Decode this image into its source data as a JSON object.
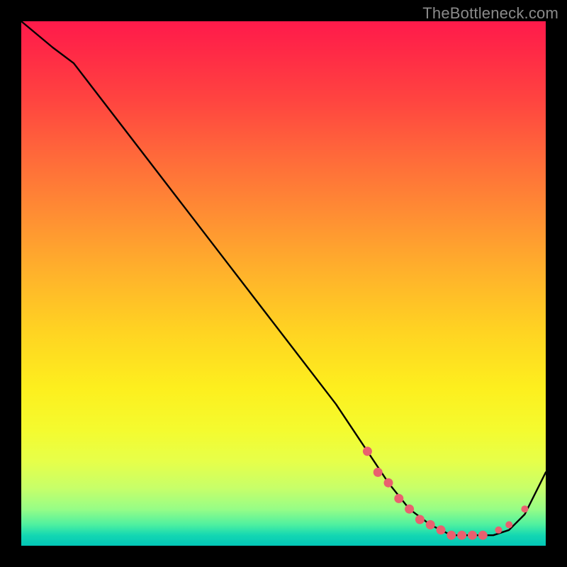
{
  "watermark": "TheBottleneck.com",
  "chart_data": {
    "type": "line",
    "title": "",
    "xlabel": "",
    "ylabel": "",
    "xlim": [
      0,
      100
    ],
    "ylim": [
      0,
      100
    ],
    "series": [
      {
        "name": "curve",
        "x": [
          0,
          6,
          10,
          20,
          30,
          40,
          50,
          60,
          66,
          70,
          74,
          78,
          82,
          86,
          90,
          93,
          96,
          100
        ],
        "values": [
          100,
          95,
          92,
          79,
          66,
          53,
          40,
          27,
          18,
          12,
          7,
          4,
          2,
          2,
          2,
          3,
          6,
          14
        ]
      }
    ],
    "markers": {
      "name": "highlight-dots",
      "x": [
        66,
        68,
        70,
        72,
        74,
        76,
        78,
        80,
        82,
        84,
        86,
        88,
        91,
        93,
        96
      ],
      "values": [
        18,
        14,
        12,
        9,
        7,
        5,
        4,
        3,
        2,
        2,
        2,
        2,
        3,
        4,
        7
      ],
      "color": "#e9606f"
    },
    "gradient_stops": [
      {
        "pos": 0,
        "color": "#ff1a4b"
      },
      {
        "pos": 15,
        "color": "#ff4440"
      },
      {
        "pos": 37,
        "color": "#ff8e33"
      },
      {
        "pos": 59,
        "color": "#ffd322"
      },
      {
        "pos": 78,
        "color": "#f4fb2f"
      },
      {
        "pos": 93,
        "color": "#97fd86"
      },
      {
        "pos": 100,
        "color": "#02c6b7"
      }
    ]
  }
}
